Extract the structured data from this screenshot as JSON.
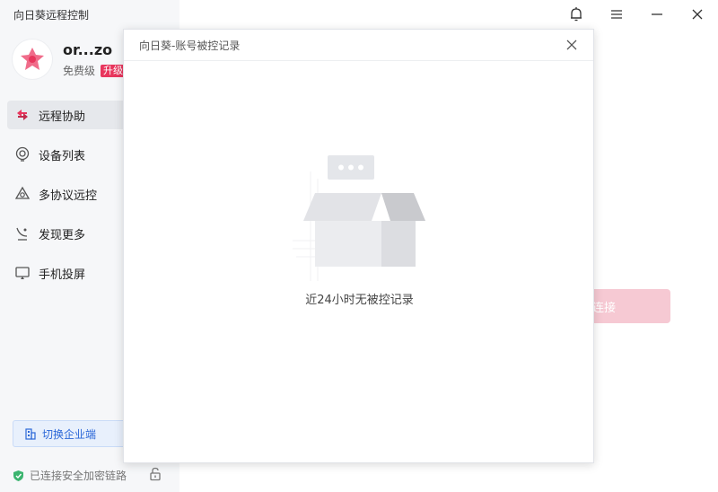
{
  "app": {
    "title": "向日葵远程控制"
  },
  "user": {
    "name": "or...zo",
    "plan": "免费级",
    "upgrade_label": "升级"
  },
  "nav": {
    "items": [
      {
        "label": "远程协助",
        "icon": "remote-assist-icon",
        "active": true
      },
      {
        "label": "设备列表",
        "icon": "device-list-icon"
      },
      {
        "label": "多协议远控",
        "icon": "multi-protocol-icon"
      },
      {
        "label": "发现更多",
        "icon": "discover-icon"
      },
      {
        "label": "手机投屏",
        "icon": "screen-cast-icon"
      }
    ]
  },
  "footer": {
    "enterprise_label": "切换企业端",
    "secure_label": "已连接安全加密链路"
  },
  "main": {
    "connect_label": "连接"
  },
  "dialog": {
    "title": "向日葵-账号被控记录",
    "empty_text": "近24小时无被控记录"
  },
  "colors": {
    "brand": "#e8365d",
    "sidebar_bg": "#f6f7f9",
    "enterprise_blue": "#2b67d8",
    "secure_green": "#3bb46f"
  }
}
